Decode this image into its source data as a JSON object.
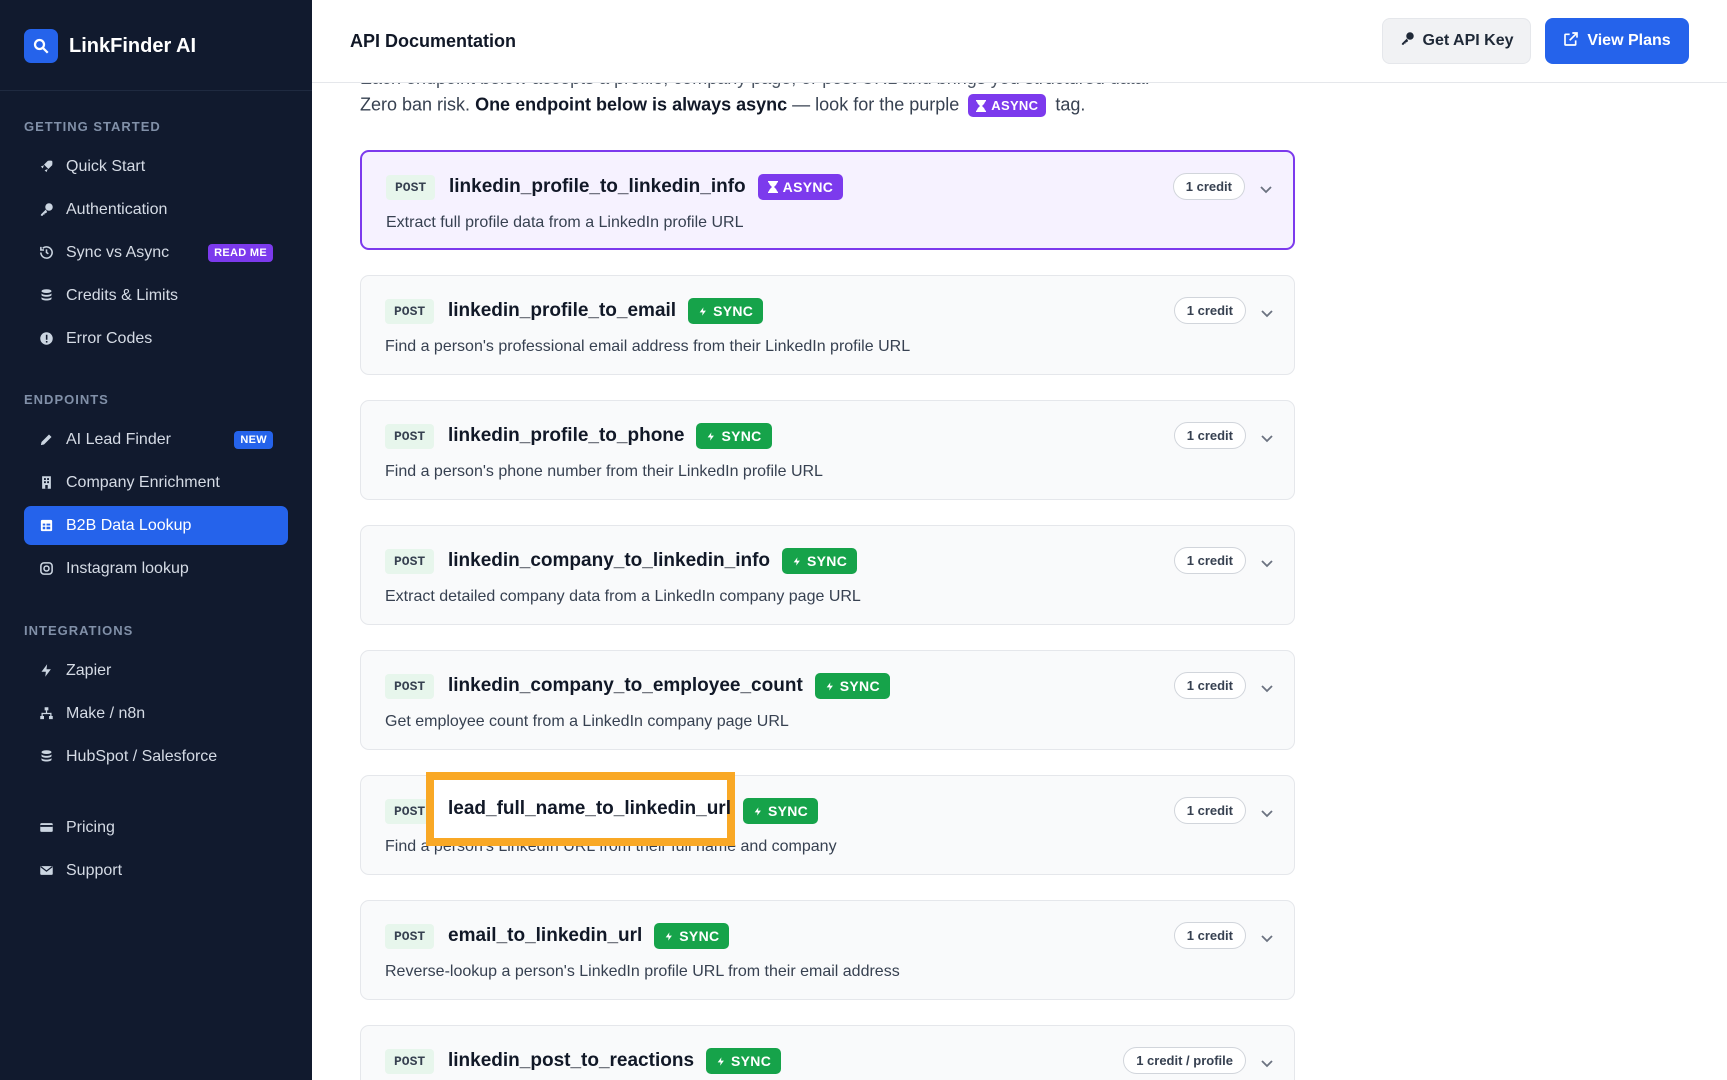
{
  "sidebar": {
    "brand": "LinkFinder AI",
    "sections": [
      {
        "title": "GETTING STARTED"
      },
      {
        "title": "ENDPOINTS"
      },
      {
        "title": "INTEGRATIONS"
      }
    ],
    "items": [
      {
        "label": "Quick Start",
        "icon": "rocket-icon"
      },
      {
        "label": "Authentication",
        "icon": "key-icon"
      },
      {
        "label": "Sync vs Async",
        "icon": "history-icon",
        "badge": "READ ME"
      },
      {
        "label": "Credits & Limits",
        "icon": "coins-icon"
      },
      {
        "label": "Error Codes",
        "icon": "alert-circle-icon"
      },
      {
        "label": "AI Lead Finder",
        "icon": "pencil-icon",
        "badge": "NEW"
      },
      {
        "label": "Company Enrichment",
        "icon": "building-icon"
      },
      {
        "label": "B2B Data Lookup",
        "icon": "table-icon",
        "active": true
      },
      {
        "label": "Instagram lookup",
        "icon": "instagram-icon"
      },
      {
        "label": "Zapier",
        "icon": "bolt-icon"
      },
      {
        "label": "Make / n8n",
        "icon": "network-icon"
      },
      {
        "label": "HubSpot / Salesforce",
        "icon": "database-icon"
      },
      {
        "label": "Pricing",
        "icon": "credit-card-icon"
      },
      {
        "label": "Support",
        "icon": "mail-icon"
      }
    ]
  },
  "header": {
    "title": "API Documentation",
    "get_api_key": "Get API Key",
    "view_plans": "View Plans"
  },
  "intro": {
    "line1_partial": "Each endpoint below accepts a profile, company page, or post URL and brings you structured data.",
    "line2_start": "Zero ban risk.",
    "line2_bold": "One endpoint below is always async",
    "line2_mid": "— look for the purple",
    "tag": "ASYNC",
    "line2_end": "tag."
  },
  "colors": {
    "sidebar_bg": "#111a2e",
    "accent": "#2563eb",
    "async": "#7c3aed",
    "sync": "#16a34a",
    "highlight": "#f9a825"
  },
  "endpoints": [
    {
      "method": "POST",
      "name": "linkedin_profile_to_linkedin_info",
      "mode": "ASYNC",
      "desc": "Extract full profile data from a LinkedIn profile URL",
      "credit": "1 credit"
    },
    {
      "method": "POST",
      "name": "linkedin_profile_to_email",
      "mode": "SYNC",
      "desc": "Find a person's professional email address from their LinkedIn profile URL",
      "credit": "1 credit"
    },
    {
      "method": "POST",
      "name": "linkedin_profile_to_phone",
      "mode": "SYNC",
      "desc": "Find a person's phone number from their LinkedIn profile URL",
      "credit": "1 credit"
    },
    {
      "method": "POST",
      "name": "linkedin_company_to_linkedin_info",
      "mode": "SYNC",
      "desc": "Extract detailed company data from a LinkedIn company page URL",
      "credit": "1 credit"
    },
    {
      "method": "POST",
      "name": "linkedin_company_to_employee_count",
      "mode": "SYNC",
      "desc": "Get employee count from a LinkedIn company page URL",
      "credit": "1 credit"
    },
    {
      "method": "POST",
      "name": "lead_full_name_to_linkedin_url",
      "mode": "SYNC",
      "desc": "Find a person's LinkedIn URL from their full name and company",
      "credit": "1 credit"
    },
    {
      "method": "POST",
      "name": "email_to_linkedin_url",
      "mode": "SYNC",
      "desc": "Reverse-lookup a person's LinkedIn profile URL from their email address",
      "credit": "1 credit"
    },
    {
      "method": "POST",
      "name": "linkedin_post_to_reactions",
      "mode": "SYNC",
      "desc": "",
      "credit": "1 credit / profile"
    }
  ],
  "highlight_label": "lead_full_name_to_linkedin_url"
}
